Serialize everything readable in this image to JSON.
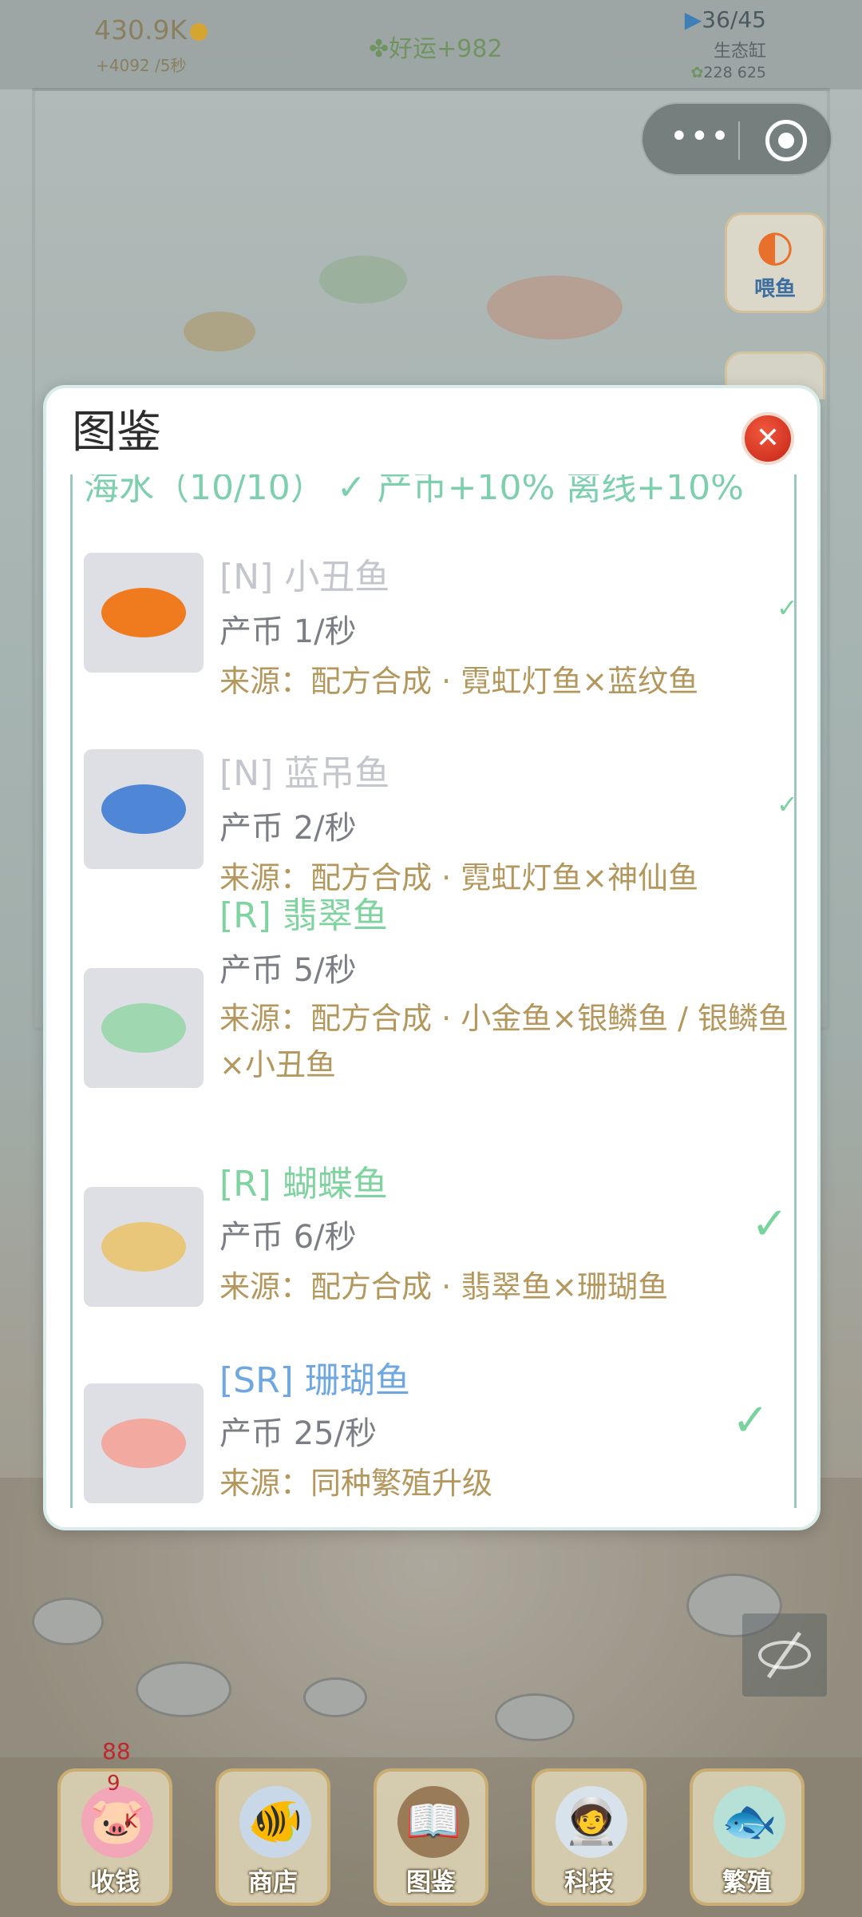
{
  "hud": {
    "coins": "430.9K",
    "coin_rate": "+4092 /5秒",
    "luck": "好运+982",
    "eco_count": "36/45",
    "eco_label": "生态缸",
    "resources": "228 625"
  },
  "side_button": {
    "label": "喂鱼"
  },
  "modal": {
    "title": "图鉴",
    "close_symbol": "✕",
    "section_header": "海水（10/10） ✓ 产币+10% 离线+10%",
    "entries": [
      {
        "name": "[N] 小丑鱼",
        "rate": "产币 1/秒",
        "source": "来源：配方合成 · 霓虹灯鱼×蓝纹鱼",
        "name_color": "#c3c6cc",
        "fish_color": "#f07a1e",
        "owned": true
      },
      {
        "name": "[N] 蓝吊鱼",
        "rate": "产币 2/秒",
        "source": "来源：配方合成 · 霓虹灯鱼×神仙鱼",
        "name_color": "#c3c6cc",
        "fish_color": "#4f86d6",
        "owned": true
      },
      {
        "name": "[R] 翡翠鱼",
        "rate": "产币 5/秒",
        "source": "来源：配方合成 · 小金鱼×银鳞鱼 / 银鳞鱼×小丑鱼",
        "name_color": "#7fd39e",
        "fish_color": "#9fd7b0",
        "owned": false
      },
      {
        "name": "[R] 蝴蝶鱼",
        "rate": "产币 6/秒",
        "source": "来源：配方合成 · 翡翠鱼×珊瑚鱼",
        "name_color": "#7fd39e",
        "fish_color": "#e9c77a",
        "owned": true
      },
      {
        "name": "[SR] 珊瑚鱼",
        "rate": "产币 25/秒",
        "source": "来源：同种繁殖升级",
        "name_color": "#6fa8e0",
        "fish_color": "#f2a9a0",
        "owned": true
      }
    ],
    "check_symbol": "✓"
  },
  "bottom_nav": {
    "items": [
      {
        "label": "收钱",
        "icon": "piggy-bank-icon",
        "glyph": "🐷"
      },
      {
        "label": "商店",
        "icon": "fish-shop-icon",
        "glyph": "🐠"
      },
      {
        "label": "图鉴",
        "icon": "book-icon",
        "glyph": "📖"
      },
      {
        "label": "科技",
        "icon": "astronaut-icon",
        "glyph": "🧑‍🚀"
      },
      {
        "label": "繁殖",
        "icon": "breeding-icon",
        "glyph": "🐟"
      }
    ],
    "badge_88": "88",
    "badge_9": "9",
    "badge_k": "K"
  }
}
